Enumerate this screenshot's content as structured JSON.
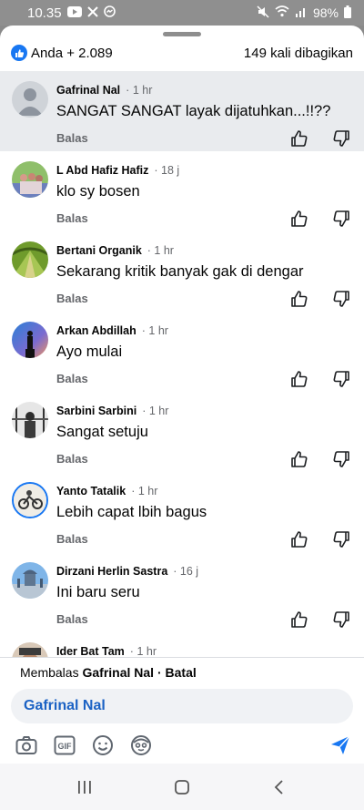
{
  "status_bar": {
    "time": "10.35",
    "battery": "98%"
  },
  "reactions": {
    "summary": "Anda + 2.089",
    "shares": "149 kali dibagikan"
  },
  "comments": [
    {
      "name": "Gafrinal Nal",
      "time": "1 hr",
      "text": "SANGAT SANGAT layak dijatuhkan...!!??",
      "reply": "Balas"
    },
    {
      "name": "L Abd Hafiz Hafiz",
      "time": "18 j",
      "text": "klo sy bosen",
      "reply": "Balas"
    },
    {
      "name": "Bertani Organik",
      "time": "1 hr",
      "text": "Sekarang kritik banyak gak di dengar",
      "reply": "Balas"
    },
    {
      "name": "Arkan Abdillah",
      "time": "1 hr",
      "text": "Ayo mulai",
      "reply": "Balas"
    },
    {
      "name": "Sarbini Sarbini",
      "time": "1 hr",
      "text": "Sangat setuju",
      "reply": "Balas"
    },
    {
      "name": "Yanto Tatalik",
      "time": "1 hr",
      "text": "Lebih capat lbih bagus",
      "reply": "Balas"
    },
    {
      "name": "Dirzani Herlin Sastra",
      "time": "16 j",
      "text": "Ini baru seru",
      "reply": "Balas"
    },
    {
      "name": "Ider Bat Tam",
      "time": "1 hr",
      "text": "",
      "reply": ""
    }
  ],
  "reply": {
    "prefix": "Membalas",
    "target": "Gafrinal Nal",
    "separator": "·",
    "cancel": "Batal",
    "input_value": "Gafrinal Nal"
  },
  "toolbar": {
    "gif_label": "GIF"
  },
  "colors": {
    "facebook_blue": "#1877f2",
    "mention_blue": "#1b62c4",
    "highlight_bg": "#e9ebee"
  },
  "icons": [
    "youtube-icon",
    "x-icon",
    "messenger-icon",
    "mute-icon",
    "wifi-icon",
    "signal-icon",
    "battery-icon",
    "like-icon",
    "thumbs-up-icon",
    "thumbs-down-icon",
    "camera-icon",
    "gif-icon",
    "emoji-icon",
    "avatar-sticker-icon",
    "send-icon",
    "recents-icon",
    "home-icon",
    "back-icon"
  ]
}
